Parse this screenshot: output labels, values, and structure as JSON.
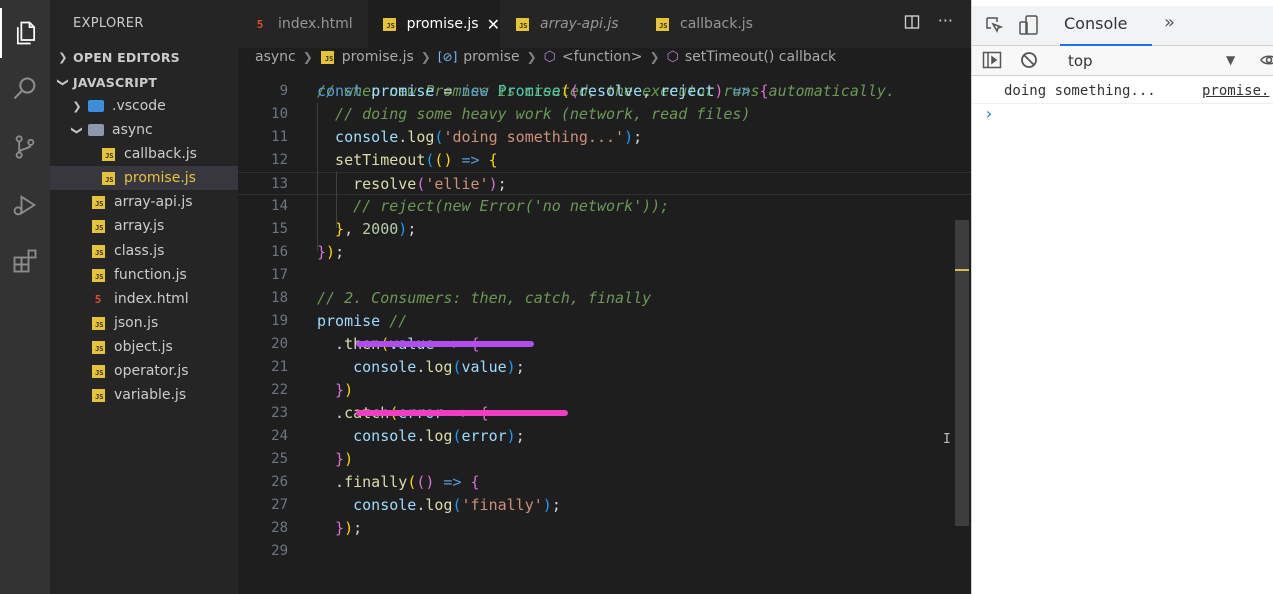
{
  "colors": {
    "activity_bg": "#333333",
    "sidebar_bg": "#252526",
    "editor_bg": "#1e1e1e",
    "js_icon": "#e5c33b",
    "html_icon": "#e44d26",
    "strike_purple": "#b14cf0",
    "strike_pink": "#ef3ec3",
    "devtools_accent": "#1a73e8"
  },
  "activity_bar": {
    "icons": [
      "files-icon",
      "search-icon",
      "source-control-icon",
      "run-debug-icon",
      "extensions-icon"
    ]
  },
  "sidebar": {
    "title": "EXPLORER",
    "open_editors": "OPEN EDITORS",
    "root": "JAVASCRIPT",
    "items": [
      {
        "label": ".vscode",
        "kind": "folder"
      },
      {
        "label": "async",
        "kind": "folder"
      },
      {
        "label": "callback.js",
        "kind": "js"
      },
      {
        "label": "promise.js",
        "kind": "js"
      },
      {
        "label": "array-api.js",
        "kind": "js"
      },
      {
        "label": "array.js",
        "kind": "js"
      },
      {
        "label": "class.js",
        "kind": "js"
      },
      {
        "label": "function.js",
        "kind": "js"
      },
      {
        "label": "index.html",
        "kind": "html"
      },
      {
        "label": "json.js",
        "kind": "js"
      },
      {
        "label": "object.js",
        "kind": "js"
      },
      {
        "label": "operator.js",
        "kind": "js"
      },
      {
        "label": "variable.js",
        "kind": "js"
      }
    ]
  },
  "tabs": [
    {
      "label": "index.html",
      "kind": "html"
    },
    {
      "label": "promise.js",
      "kind": "js",
      "close": "✕"
    },
    {
      "label": "array-api.js",
      "kind": "js"
    },
    {
      "label": "callback.js",
      "kind": "js"
    }
  ],
  "breadcrumb": [
    "async",
    "promise.js",
    "promise",
    "<function>",
    "setTimeout() callback"
  ],
  "editor": {
    "partial_top_comment": "// when new Promise is created, the executor runs automatically.",
    "line_numbers": [
      "9",
      "10",
      "11",
      "12",
      "13",
      "14",
      "15",
      "16",
      "17",
      "18",
      "19",
      "20",
      "21",
      "22",
      "23",
      "24",
      "25",
      "26",
      "27",
      "28",
      "29"
    ],
    "lines": [
      [
        [
          "const ",
          "kw"
        ],
        [
          "promise",
          "var"
        ],
        [
          " = ",
          "p"
        ],
        [
          "new ",
          "kw"
        ],
        [
          "Promise",
          "cls"
        ],
        [
          "(",
          "b1"
        ],
        [
          "(",
          "b2"
        ],
        [
          "resolve",
          "var"
        ],
        [
          ", ",
          "p"
        ],
        [
          "reject",
          "var"
        ],
        [
          ")",
          "b2"
        ],
        [
          " => ",
          "kw"
        ],
        [
          "{",
          "b2"
        ]
      ],
      [
        [
          "  // doing some heavy work (network, read files)",
          "cmt"
        ]
      ],
      [
        [
          "  console",
          "var"
        ],
        [
          ".",
          "p"
        ],
        [
          "log",
          "fn"
        ],
        [
          "(",
          "b3"
        ],
        [
          "'doing something...'",
          "str"
        ],
        [
          ")",
          "b3"
        ],
        [
          ";",
          "p"
        ]
      ],
      [
        [
          "  setTimeout",
          "fn"
        ],
        [
          "(",
          "b3"
        ],
        [
          "(",
          "b1"
        ],
        [
          ")",
          "b1"
        ],
        [
          " => ",
          "kw"
        ],
        [
          "{",
          "b1"
        ]
      ],
      [
        [
          "    resolve",
          "fn"
        ],
        [
          "(",
          "b2"
        ],
        [
          "'ellie'",
          "str"
        ],
        [
          ")",
          "b2"
        ],
        [
          ";",
          "p"
        ]
      ],
      [
        [
          "    // reject(new Error('no network'));",
          "cmt"
        ]
      ],
      [
        [
          "  }",
          "b1"
        ],
        [
          ", ",
          "p"
        ],
        [
          "2000",
          "num"
        ],
        [
          ")",
          "b3"
        ],
        [
          ";",
          "p"
        ]
      ],
      [
        [
          "}",
          "b2"
        ],
        [
          ")",
          "b1"
        ],
        [
          ";",
          "p"
        ]
      ],
      [],
      [
        [
          "// 2. Consumers: then, catch, finally",
          "cmt"
        ]
      ],
      [
        [
          "promise",
          "var"
        ],
        [
          " //",
          "cmt"
        ]
      ],
      [
        [
          "  .",
          "p"
        ],
        [
          "then",
          "fn"
        ],
        [
          "(",
          "b1"
        ],
        [
          "value",
          "var"
        ],
        [
          " => ",
          "kw"
        ],
        [
          "{",
          "b2"
        ]
      ],
      [
        [
          "    console",
          "var"
        ],
        [
          ".",
          "p"
        ],
        [
          "log",
          "fn"
        ],
        [
          "(",
          "b3"
        ],
        [
          "value",
          "var"
        ],
        [
          ")",
          "b3"
        ],
        [
          ";",
          "p"
        ]
      ],
      [
        [
          "  }",
          "b2"
        ],
        [
          ")",
          "b1"
        ]
      ],
      [
        [
          "  .",
          "p"
        ],
        [
          "catch",
          "fn"
        ],
        [
          "(",
          "b1"
        ],
        [
          "error",
          "var"
        ],
        [
          " => ",
          "kw"
        ],
        [
          "{",
          "b2"
        ]
      ],
      [
        [
          "    console",
          "var"
        ],
        [
          ".",
          "p"
        ],
        [
          "log",
          "fn"
        ],
        [
          "(",
          "b3"
        ],
        [
          "error",
          "var"
        ],
        [
          ")",
          "b3"
        ],
        [
          ";",
          "p"
        ]
      ],
      [
        [
          "  }",
          "b2"
        ],
        [
          ")",
          "b1"
        ]
      ],
      [
        [
          "  .",
          "p"
        ],
        [
          "finally",
          "fn"
        ],
        [
          "(",
          "b1"
        ],
        [
          "(",
          "b2"
        ],
        [
          ")",
          "b2"
        ],
        [
          " => ",
          "kw"
        ],
        [
          "{",
          "b2"
        ]
      ],
      [
        [
          "    console",
          "var"
        ],
        [
          ".",
          "p"
        ],
        [
          "log",
          "fn"
        ],
        [
          "(",
          "b3"
        ],
        [
          "'finally'",
          "str"
        ],
        [
          ")",
          "b3"
        ],
        [
          ";",
          "p"
        ]
      ],
      [
        [
          "  }",
          "b2"
        ],
        [
          ")",
          "b1"
        ],
        [
          ";",
          "p"
        ]
      ],
      []
    ]
  },
  "devtools": {
    "tab": "Console",
    "more": "»",
    "context": "top",
    "log_message": "doing something...",
    "log_source": "promise.",
    "prompt": "›"
  }
}
